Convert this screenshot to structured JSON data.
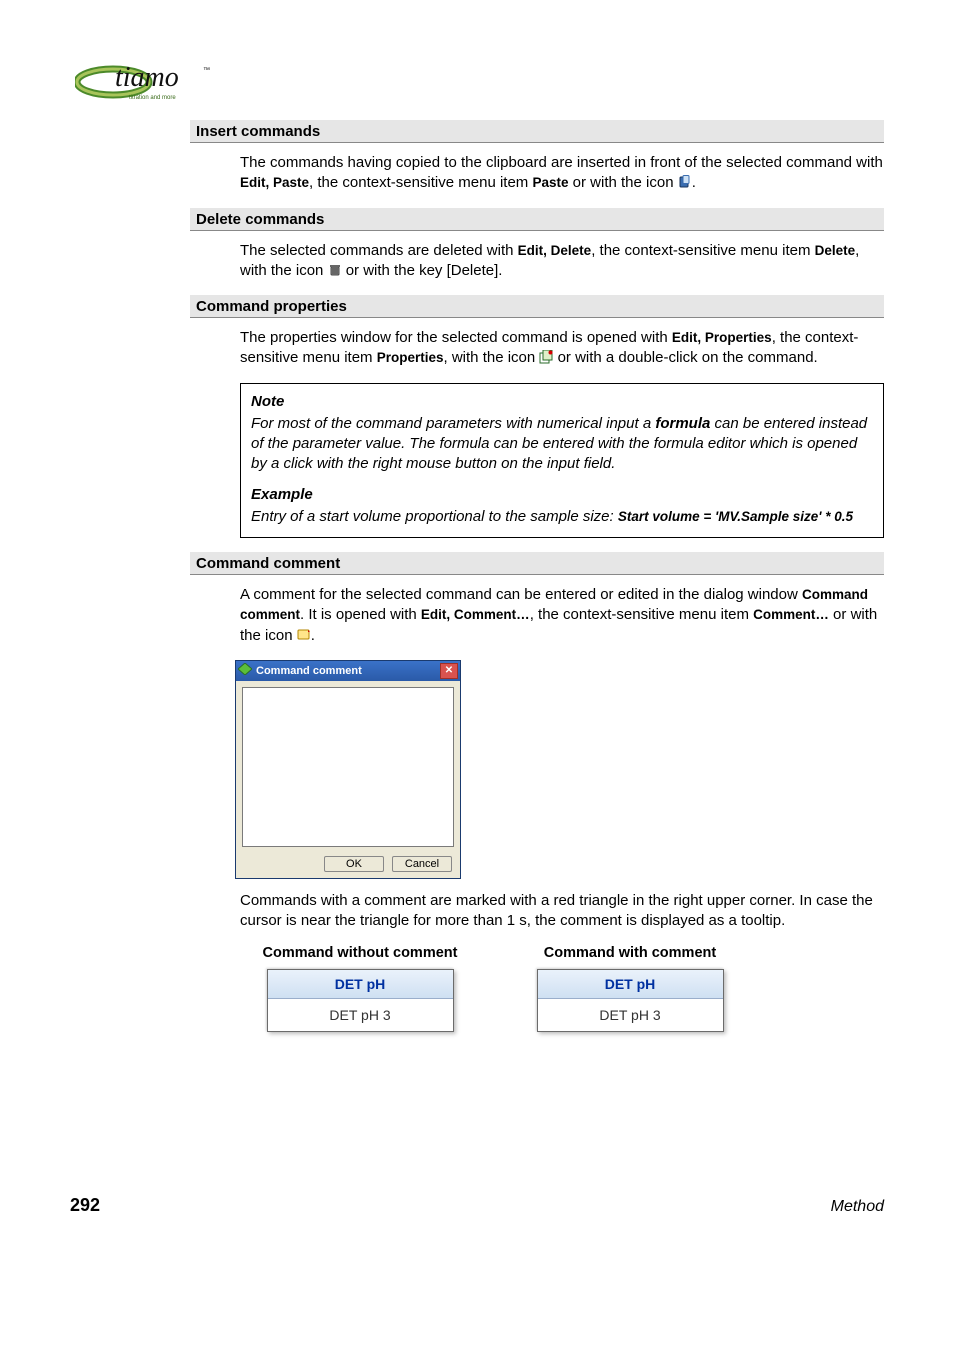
{
  "logo_alt": "tiamo logo",
  "logo_sub": "titration and more",
  "sections": {
    "insert": {
      "title": "Insert commands",
      "para_a": "The commands having copied to the clipboard are inserted in front of the selected command with ",
      "bold_a": "Edit, Paste",
      "para_b": ", the context-sensitive menu item ",
      "bold_b": "Paste",
      "para_c": " or with the icon ",
      "para_d": "."
    },
    "delete": {
      "title": "Delete commands",
      "para_a": "The selected commands are deleted with ",
      "bold_a": "Edit, Delete",
      "para_b": ", the context-sensitive menu item ",
      "bold_b": "Delete",
      "para_c": ", with the icon ",
      "para_d": " or with the key [Delete]."
    },
    "props": {
      "title": "Command properties",
      "para_a": "The properties window for the selected command is opened with ",
      "bold_a": "Edit, Properties",
      "para_b": ", the context-sensitive menu item ",
      "bold_b": "Properties",
      "para_c": ", with the icon ",
      "para_d": " or with a double-click on the command."
    },
    "note": {
      "title": "Note",
      "text_a": "For most of the command parameters with numerical input a ",
      "formula_word": "formula",
      "text_b": " can be entered instead of the parameter value. The formula can be entered with the formula editor which is opened by a click with the right mouse button on the input field."
    },
    "example": {
      "title": "Example",
      "text_a": "Entry of a start volume proportional to the sample size: ",
      "code": "Start volume = 'MV.Sample size' * 0.5"
    },
    "comment": {
      "title": "Command comment",
      "para_a": "A comment for the selected command can be entered or edited in the dialog window ",
      "bold_a": "Command comment",
      "para_b": ". It is opened with ",
      "bold_b": "Edit, Comment…",
      "para_c": ", the context-sensitive menu item ",
      "bold_c": "Comment…",
      "para_d": " or with the icon ",
      "para_e": ".",
      "after_dialog": "Commands with a comment are marked with a red triangle in the right upper corner. In case the cursor is near the triangle for more than 1 s, the comment is displayed as a tooltip."
    }
  },
  "dialog": {
    "title": "Command comment",
    "ok": "OK",
    "cancel": "Cancel"
  },
  "compare": {
    "left_title": "Command without comment",
    "right_title": "Command with comment",
    "box_top": "DET pH",
    "box_bottom": "DET pH 3"
  },
  "footer": {
    "page": "292",
    "section": "Method"
  }
}
